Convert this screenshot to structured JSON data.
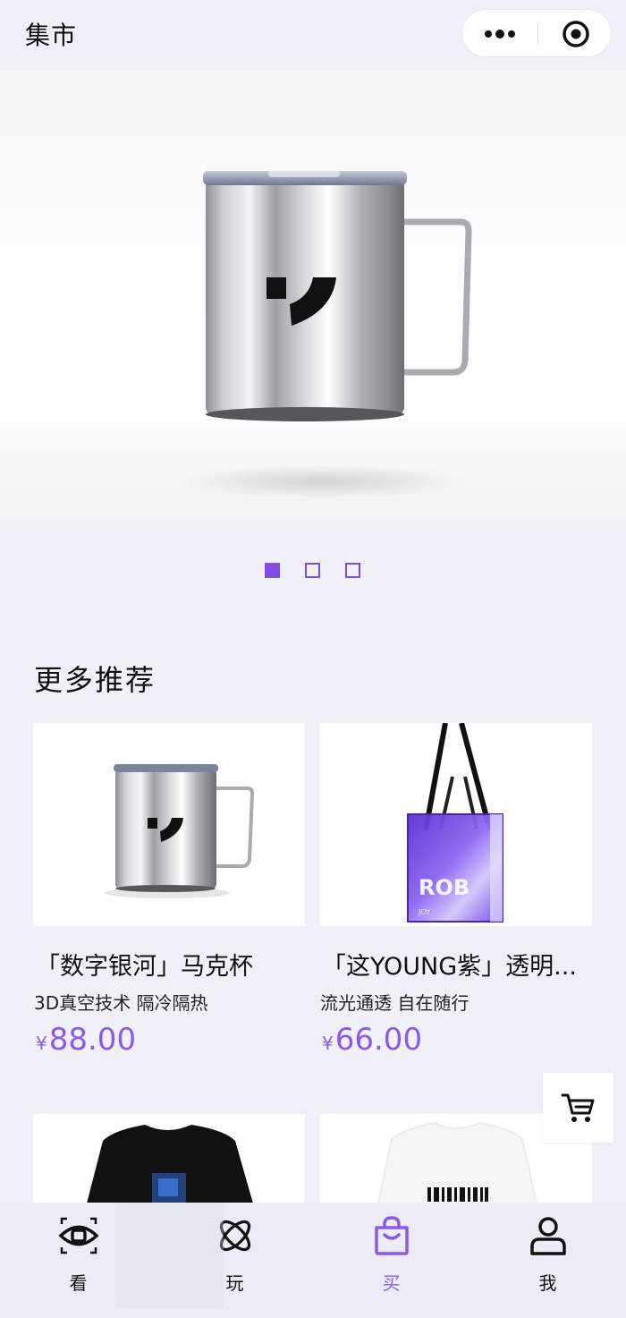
{
  "header": {
    "title": "集市",
    "more_icon": "more-dots-icon",
    "close_icon": "target-close-icon"
  },
  "banner": {
    "slides_total": 3,
    "active_index": 0
  },
  "section": {
    "title": "更多推荐"
  },
  "products": [
    {
      "name": "「数字银河」马克杯",
      "desc": "3D真空技术 隔冷隔热",
      "currency": "¥",
      "price": "88.00"
    },
    {
      "name": "「这YOUNG紫」透明...",
      "desc": "流光通透 自在随行",
      "currency": "¥",
      "price": "66.00"
    }
  ],
  "cart": {
    "icon": "shopping-cart-icon"
  },
  "tabs": [
    {
      "label": "看",
      "icon": "eye-icon",
      "active": false
    },
    {
      "label": "玩",
      "icon": "atom-icon",
      "active": false
    },
    {
      "label": "买",
      "icon": "shopping-bag-icon",
      "active": true
    },
    {
      "label": "我",
      "icon": "user-icon",
      "active": false
    }
  ],
  "colors": {
    "accent": "#8a5ce6",
    "background": "#f0f0f9"
  }
}
